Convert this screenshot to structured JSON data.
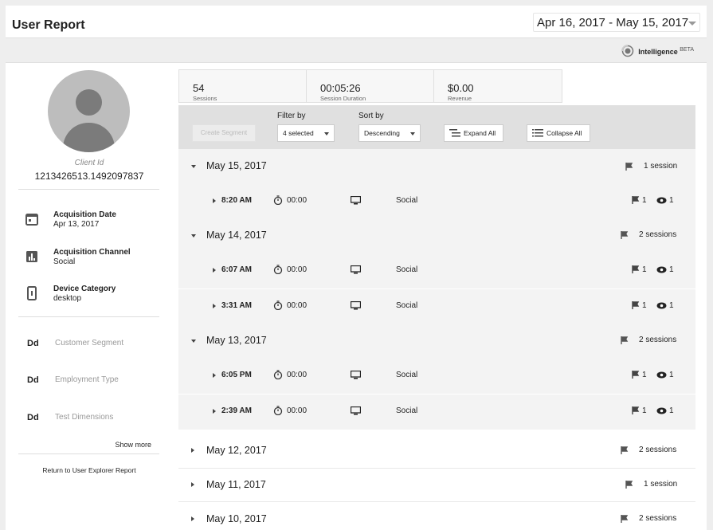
{
  "header": {
    "title": "User Report",
    "date_range": "Apr 16, 2017 - May 15, 2017"
  },
  "intelligence": {
    "label": "Intelligence",
    "badge": "BETA"
  },
  "profile": {
    "client_id_label": "Client Id",
    "client_id": "1213426513.1492097837",
    "acquisition": [
      {
        "label": "Acquisition Date",
        "value": "Apr 13, 2017",
        "icon": "calendar-icon"
      },
      {
        "label": "Acquisition Channel",
        "value": "Social",
        "icon": "bar-chart-icon"
      },
      {
        "label": "Device Category",
        "value": "desktop",
        "icon": "device-icon"
      }
    ],
    "dimensions": [
      {
        "icon": "Dd",
        "label": "Customer Segment"
      },
      {
        "icon": "Dd",
        "label": "Employment Type"
      },
      {
        "icon": "Dd",
        "label": "Test Dimensions"
      }
    ],
    "show_more": "Show more",
    "return_link": "Return to User Explorer Report"
  },
  "stats": [
    {
      "value": "54",
      "label": "Sessions"
    },
    {
      "value": "00:05:26",
      "label": "Session Duration"
    },
    {
      "value": "$0.00",
      "label": "Revenue"
    }
  ],
  "toolbar": {
    "create_segment": "Create Segment",
    "filter_label": "Filter by",
    "filter_value": "4 selected",
    "sort_label": "Sort by",
    "sort_value": "Descending",
    "expand_all": "Expand All",
    "collapse_all": "Collapse All"
  },
  "days": [
    {
      "date": "May 15, 2017",
      "count": "1 session",
      "expanded": true,
      "sessions": [
        {
          "time": "8:20 AM",
          "duration": "00:00",
          "channel": "Social",
          "events": "1",
          "views": "1"
        }
      ]
    },
    {
      "date": "May 14, 2017",
      "count": "2 sessions",
      "expanded": true,
      "sessions": [
        {
          "time": "6:07 AM",
          "duration": "00:00",
          "channel": "Social",
          "events": "1",
          "views": "1"
        },
        {
          "time": "3:31 AM",
          "duration": "00:00",
          "channel": "Social",
          "events": "1",
          "views": "1"
        }
      ]
    },
    {
      "date": "May 13, 2017",
      "count": "2 sessions",
      "expanded": true,
      "sessions": [
        {
          "time": "6:05 PM",
          "duration": "00:00",
          "channel": "Social",
          "events": "1",
          "views": "1"
        },
        {
          "time": "2:39 AM",
          "duration": "00:00",
          "channel": "Social",
          "events": "1",
          "views": "1"
        }
      ]
    },
    {
      "date": "May 12, 2017",
      "count": "2 sessions",
      "expanded": false,
      "sessions": []
    },
    {
      "date": "May 11, 2017",
      "count": "1 session",
      "expanded": false,
      "sessions": []
    },
    {
      "date": "May 10, 2017",
      "count": "2 sessions",
      "expanded": false,
      "sessions": []
    }
  ]
}
